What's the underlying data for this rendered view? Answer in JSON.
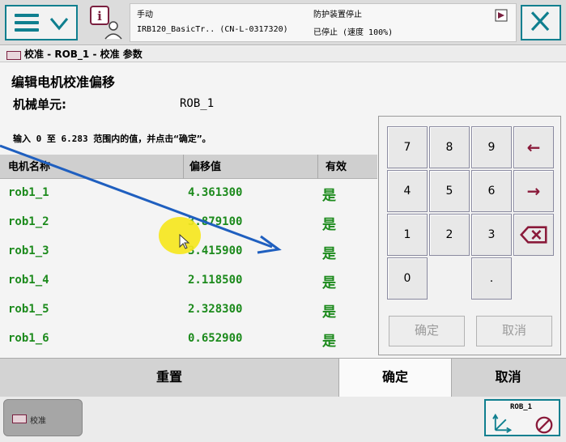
{
  "topbar": {
    "status_mode": "手动",
    "status_robot": "IRB120_BasicTr.. (CN-L-0317320)",
    "status_safety": "防护装置停止",
    "status_state": "已停止 (速度 100%)"
  },
  "breadcrumb": "校准 - ROB_1 - 校准 参数",
  "page": {
    "title": "编辑电机校准偏移",
    "mech_unit_label": "机械单元:",
    "mech_unit_value": "ROB_1",
    "instruction": "输入 0 至 6.283 范围内的值，并点击“确定”。"
  },
  "table": {
    "headers": [
      "电机名称",
      "偏移值",
      "有效"
    ],
    "rows": [
      {
        "name": "rob1_1",
        "offset": "4.361300",
        "valid": "是"
      },
      {
        "name": "rob1_2",
        "offset": "3.879100",
        "valid": "是"
      },
      {
        "name": "rob1_3",
        "offset": "3.415900",
        "valid": "是"
      },
      {
        "name": "rob1_4",
        "offset": "2.118500",
        "valid": "是"
      },
      {
        "name": "rob1_5",
        "offset": "2.328300",
        "valid": "是"
      },
      {
        "name": "rob1_6",
        "offset": "0.652900",
        "valid": "是"
      }
    ]
  },
  "keypad": {
    "digits": [
      "7",
      "8",
      "9",
      "4",
      "5",
      "6",
      "1",
      "2",
      "3",
      "0",
      "."
    ],
    "confirm": "确定",
    "cancel": "取消"
  },
  "actions": {
    "reset": "重置",
    "ok": "确定",
    "cancel": "取消"
  },
  "taskbar": {
    "calib_label": "校准",
    "robot_label": "ROB_1"
  },
  "colors": {
    "accent": "#0f7f8f",
    "value_green": "#1c8a1c",
    "keypad_arrow": "#8a1a3a"
  }
}
